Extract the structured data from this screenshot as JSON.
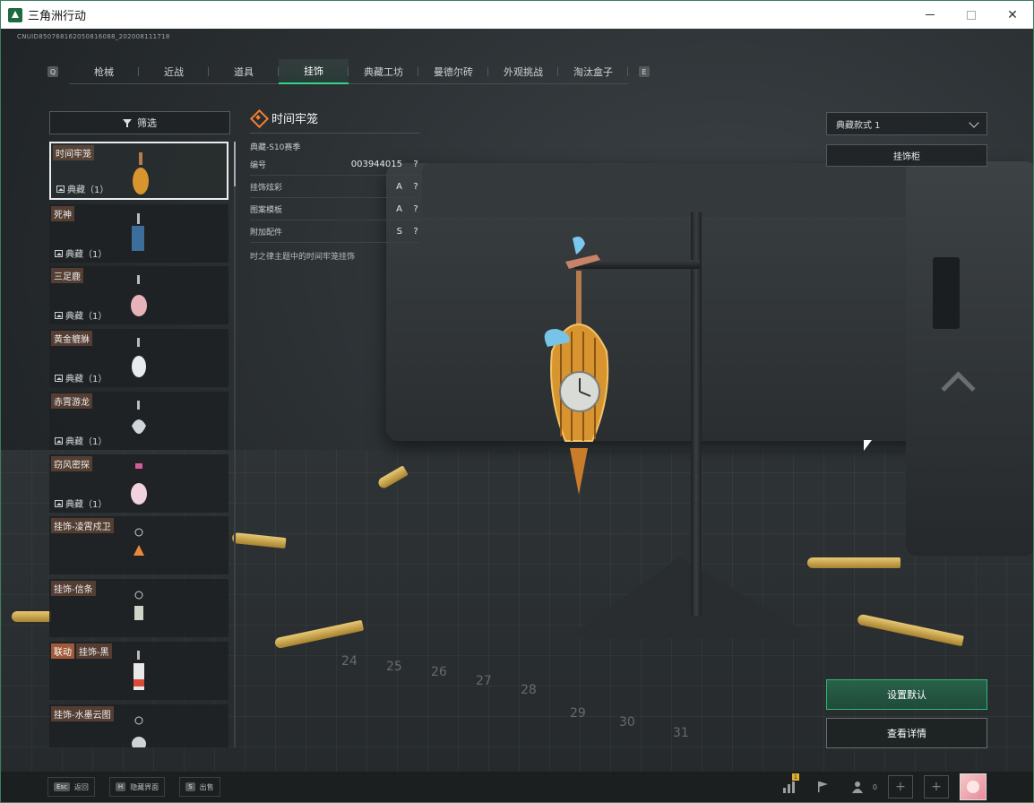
{
  "window": {
    "title": "三角洲行动",
    "close_glyph": "✕"
  },
  "uid": "CNUID850768162050816088_202008111718",
  "tabs": {
    "left_key": "Q",
    "right_key": "E",
    "items": [
      {
        "label": "枪械"
      },
      {
        "label": "近战"
      },
      {
        "label": "道具"
      },
      {
        "label": "挂饰",
        "active": true
      },
      {
        "label": "典藏工坊"
      },
      {
        "label": "曼德尔砖"
      },
      {
        "label": "外观挑战"
      },
      {
        "label": "淘汰盒子"
      }
    ]
  },
  "filter": {
    "label": "筛选"
  },
  "list": [
    {
      "name": "时间牢笼",
      "rarity": "典藏（1）",
      "selected": true
    },
    {
      "name": "死神",
      "rarity": "典藏（1）"
    },
    {
      "name": "三足鹿",
      "rarity": "典藏（1）"
    },
    {
      "name": "黄金貔貅",
      "rarity": "典藏（1）"
    },
    {
      "name": "赤霄游龙",
      "rarity": "典藏（1）"
    },
    {
      "name": "窃风密探",
      "rarity": "典藏（1）"
    },
    {
      "name": "挂饰-凌霄戍卫",
      "rarity": ""
    },
    {
      "name": "挂饰-信条",
      "rarity": ""
    },
    {
      "tag": "联动",
      "name": "挂饰-黑",
      "rarity": ""
    },
    {
      "name": "挂饰-水墨云图",
      "rarity": ""
    }
  ],
  "detail": {
    "title": "时间牢笼",
    "subtitle": "典藏-S10赛季",
    "props": [
      {
        "label": "编号",
        "value": "003944015",
        "help": "?"
      },
      {
        "label": "挂饰炫彩",
        "value": "A",
        "help": "?"
      },
      {
        "label": "图案模板",
        "value": "A",
        "help": "?"
      },
      {
        "label": "附加配件",
        "value": "S",
        "help": "?"
      }
    ],
    "description": "时之律主题中的时间牢笼挂饰"
  },
  "right": {
    "style_select": "典藏款式 1",
    "cabinet_button": "挂饰柜",
    "default_button": "设置默认",
    "details_button": "查看详情"
  },
  "grid_numbers": [
    "24",
    "25",
    "26",
    "27",
    "28",
    "29",
    "30",
    "31"
  ],
  "bottom": {
    "hints": [
      {
        "key": "Esc",
        "label": "返回"
      },
      {
        "key": "H",
        "label": "隐藏界面"
      },
      {
        "key": "S",
        "label": "出售"
      }
    ],
    "friend_count": "0",
    "badge": "1"
  },
  "colors": {
    "accent": "#37d28a",
    "rarity_orange": "#f08030",
    "tag_bg": "#a05a3a"
  }
}
